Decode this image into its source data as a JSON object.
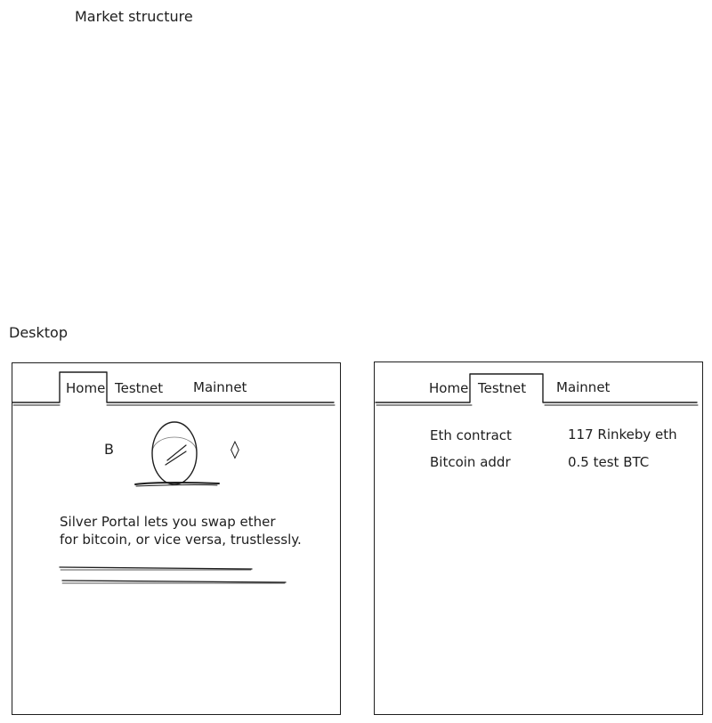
{
  "sections": {
    "market_structure": "Market structure",
    "desktop": "Desktop"
  },
  "home_screen": {
    "tabs": [
      {
        "label": "Home",
        "active": true
      },
      {
        "label": "Testnet",
        "active": false
      },
      {
        "label": "Mainnet",
        "active": false
      }
    ],
    "logo": {
      "left_symbol": "B",
      "right_symbol": "◊"
    },
    "description_lines": [
      "Silver Portal lets you swap ether",
      "for bitcoin, or vice versa, trustlessly."
    ]
  },
  "testnet_screen": {
    "tabs": [
      {
        "label": "Home",
        "active": false
      },
      {
        "label": "Testnet",
        "active": true
      },
      {
        "label": "Mainnet",
        "active": false
      }
    ],
    "rows": [
      {
        "label": "Eth contract",
        "value": "117 Rinkeby eth"
      },
      {
        "label": "Bitcoin addr",
        "value": "0.5 test BTC"
      }
    ]
  }
}
